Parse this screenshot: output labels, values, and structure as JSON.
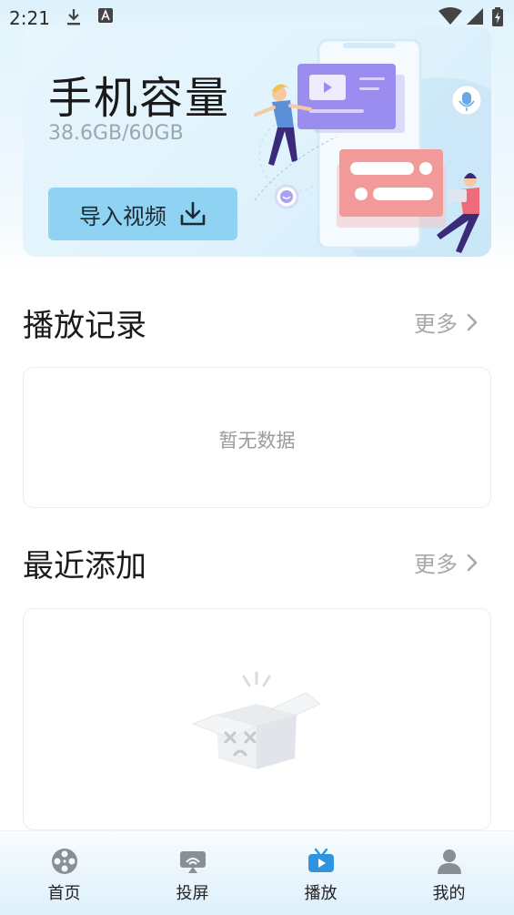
{
  "status_bar": {
    "time": "2:21"
  },
  "banner": {
    "title": "手机容量",
    "storage": "38.6GB/60GB",
    "import_label": "导入视频"
  },
  "play_history": {
    "title": "播放记录",
    "more_label": "更多",
    "empty_text": "暂无数据"
  },
  "recent": {
    "title": "最近添加",
    "more_label": "更多"
  },
  "tabs": [
    {
      "label": "首页",
      "icon": "film-reel-icon",
      "active": false
    },
    {
      "label": "投屏",
      "icon": "cast-icon",
      "active": false
    },
    {
      "label": "播放",
      "icon": "play-tv-icon",
      "active": true
    },
    {
      "label": "我的",
      "icon": "person-icon",
      "active": false
    }
  ],
  "colors": {
    "accent": "#2f93e0",
    "button_bg": "#8fd2f1",
    "inactive_icon": "#8a8f93"
  }
}
